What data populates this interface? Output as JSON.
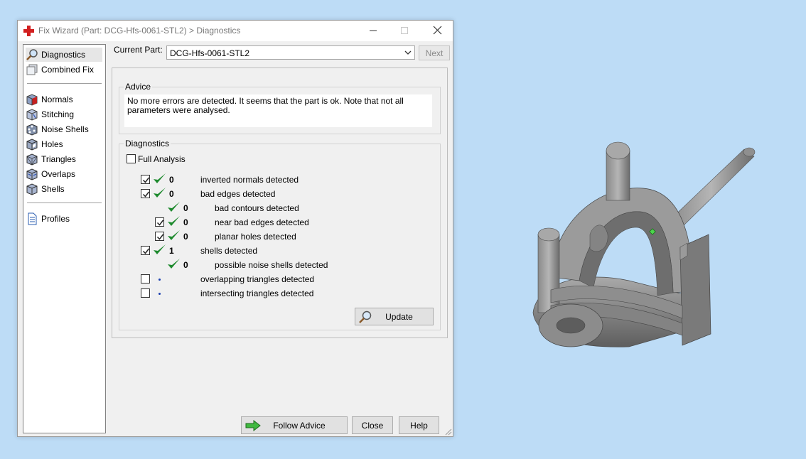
{
  "window": {
    "title": "Fix Wizard (Part: DCG-Hfs-0061-STL2) > Diagnostics"
  },
  "sidebar": {
    "items": [
      {
        "label": "Diagnostics",
        "icon": "magnifier-icon"
      },
      {
        "label": "Combined Fix",
        "icon": "combined-fix-icon"
      },
      {
        "label": "Normals",
        "icon": "normals-cube-icon"
      },
      {
        "label": "Stitching",
        "icon": "stitching-cube-icon"
      },
      {
        "label": "Noise Shells",
        "icon": "noise-shells-cube-icon"
      },
      {
        "label": "Holes",
        "icon": "holes-cube-icon"
      },
      {
        "label": "Triangles",
        "icon": "triangles-cube-icon"
      },
      {
        "label": "Overlaps",
        "icon": "overlaps-cube-icon"
      },
      {
        "label": "Shells",
        "icon": "shells-cube-icon"
      },
      {
        "label": "Profiles",
        "icon": "profiles-document-icon"
      }
    ]
  },
  "current_part": {
    "label": "Current Part:",
    "value": "DCG-Hfs-0061-STL2",
    "next_label": "Next"
  },
  "advice": {
    "title": "Advice",
    "line1": "No more errors are detected. It seems that the part is ok. Note that not all",
    "line2": "parameters were analysed."
  },
  "diagnostics": {
    "title": "Diagnostics",
    "full_analysis": "Full Analysis",
    "rows": [
      {
        "count": "0",
        "label": "inverted normals detected"
      },
      {
        "count": "0",
        "label": "bad edges detected"
      },
      {
        "count": "0",
        "label": "bad contours detected"
      },
      {
        "count": "0",
        "label": "near bad edges detected"
      },
      {
        "count": "0",
        "label": "planar holes detected"
      },
      {
        "count": "1",
        "label": "shells detected"
      },
      {
        "count": "0",
        "label": "possible noise shells detected"
      },
      {
        "count": "",
        "label": "overlapping triangles detected"
      },
      {
        "count": "",
        "label": "intersecting triangles detected"
      }
    ],
    "update_label": "Update"
  },
  "footer": {
    "follow_advice": "Follow Advice",
    "close": "Close",
    "help": "Help"
  },
  "colors": {
    "desktop": "#bddcf6",
    "check_green": "#1e8a2e",
    "dot_blue": "#1a3fb0"
  }
}
